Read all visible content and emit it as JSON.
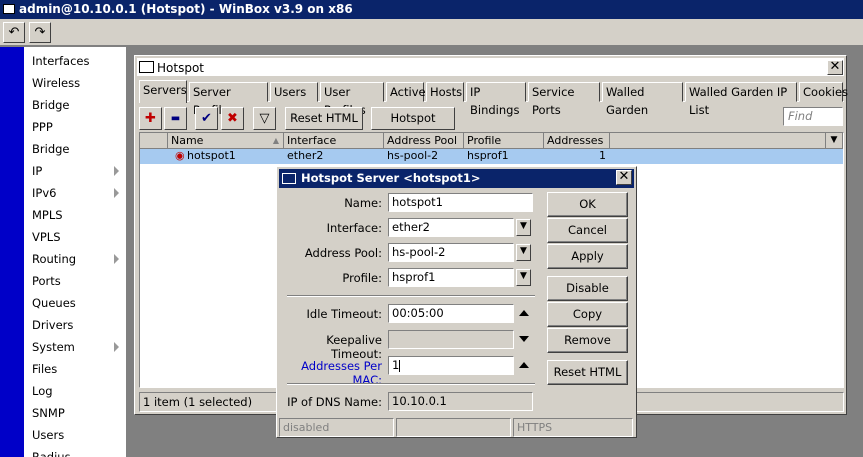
{
  "app": {
    "title": "admin@10.10.0.1 (Hotspot) - WinBox v3.9 on x86"
  },
  "toolbar": {
    "undo_glyph": "↶",
    "redo_glyph": "↷"
  },
  "sidebar": {
    "items": [
      {
        "label": "Interfaces",
        "has_submenu": false
      },
      {
        "label": "Wireless",
        "has_submenu": false
      },
      {
        "label": "Bridge",
        "has_submenu": false
      },
      {
        "label": "PPP",
        "has_submenu": false
      },
      {
        "label": "Bridge",
        "has_submenu": false
      },
      {
        "label": "IP",
        "has_submenu": true
      },
      {
        "label": "IPv6",
        "has_submenu": true
      },
      {
        "label": "MPLS",
        "has_submenu": false
      },
      {
        "label": "VPLS",
        "has_submenu": false
      },
      {
        "label": "Routing",
        "has_submenu": true
      },
      {
        "label": "Ports",
        "has_submenu": false
      },
      {
        "label": "Queues",
        "has_submenu": false
      },
      {
        "label": "Drivers",
        "has_submenu": false
      },
      {
        "label": "System",
        "has_submenu": true
      },
      {
        "label": "Files",
        "has_submenu": false
      },
      {
        "label": "Log",
        "has_submenu": false
      },
      {
        "label": "SNMP",
        "has_submenu": false
      },
      {
        "label": "Users",
        "has_submenu": false
      },
      {
        "label": "Radius",
        "has_submenu": false
      }
    ]
  },
  "hotspot": {
    "title": "Hotspot",
    "close_glyph": "✕",
    "tabs": [
      "Servers",
      "Server Profiles",
      "Users",
      "User Profiles",
      "Active",
      "Hosts",
      "IP Bindings",
      "Service Ports",
      "Walled Garden",
      "Walled Garden IP List",
      "Cookies"
    ],
    "active_tab": "Servers",
    "toolbar": {
      "add_glyph": "✚",
      "remove_glyph": "▬",
      "enable_glyph": "✔",
      "disable_glyph": "✖",
      "filter_glyph": "▽",
      "reset_html": "Reset HTML",
      "hotspot_setup": "Hotspot Setup",
      "find_placeholder": "Find"
    },
    "table": {
      "columns": [
        "Name",
        "Interface",
        "Address Pool",
        "Profile",
        "Addresses ..."
      ],
      "rows": [
        {
          "name": "hotspot1",
          "interface": "ether2",
          "address_pool": "hs-pool-2",
          "profile": "hsprof1",
          "addresses": "1"
        }
      ]
    },
    "status": "1 item (1 selected)"
  },
  "dialog": {
    "title": "Hotspot Server <hotspot1>",
    "close_glyph": "✕",
    "labels": {
      "name": "Name:",
      "interface": "Interface:",
      "address_pool": "Address Pool:",
      "profile": "Profile:",
      "idle_timeout": "Idle Timeout:",
      "keepalive_timeout": "Keepalive Timeout:",
      "addresses_per_mac": "Addresses Per MAC:",
      "ip_of_dns_name": "IP of DNS Name:"
    },
    "values": {
      "name": "hotspot1",
      "interface": "ether2",
      "address_pool": "hs-pool-2",
      "profile": "hsprof1",
      "idle_timeout": "00:05:00",
      "keepalive_timeout": "",
      "addresses_per_mac": "1",
      "ip_of_dns_name": "10.10.0.1"
    },
    "buttons": {
      "ok": "OK",
      "cancel": "Cancel",
      "apply": "Apply",
      "disable": "Disable",
      "copy": "Copy",
      "remove": "Remove",
      "reset_html": "Reset HTML"
    },
    "status": {
      "state": "disabled",
      "middle": "",
      "https": "HTTPS"
    }
  },
  "colors": {
    "title_bar": "#0a246a",
    "sidebar_strip": "#0000c8",
    "selected_row": "#a6caf0",
    "highlight_label": "#0000c8",
    "add_icon": "#c00000",
    "remove_icon": "#000080"
  }
}
